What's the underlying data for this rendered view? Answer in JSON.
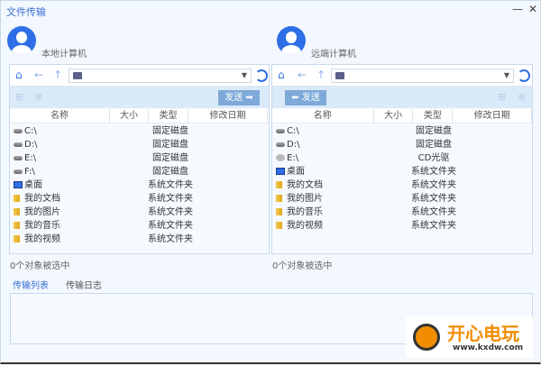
{
  "window": {
    "title": "文件传输",
    "minimize": "—",
    "close": "✕"
  },
  "local": {
    "name": "本地计算机",
    "send": "发送 ➡",
    "status": "0个对象被选中",
    "columns": [
      "名称",
      "大小",
      "类型",
      "修改日期"
    ],
    "rows": [
      {
        "name": "C:\\",
        "type": "固定磁盘",
        "icon": "drive"
      },
      {
        "name": "D:\\",
        "type": "固定磁盘",
        "icon": "drive"
      },
      {
        "name": "E:\\",
        "type": "固定磁盘",
        "icon": "drive"
      },
      {
        "name": "F:\\",
        "type": "固定磁盘",
        "icon": "drive"
      },
      {
        "name": "桌面",
        "type": "系统文件夹",
        "icon": "desktop"
      },
      {
        "name": "我的文档",
        "type": "系统文件夹",
        "icon": "folder"
      },
      {
        "name": "我的图片",
        "type": "系统文件夹",
        "icon": "folder"
      },
      {
        "name": "我的音乐",
        "type": "系统文件夹",
        "icon": "folder"
      },
      {
        "name": "我的视频",
        "type": "系统文件夹",
        "icon": "folder"
      }
    ]
  },
  "remote": {
    "name": "远端计算机",
    "send": "⬅ 发送",
    "status": "0个对象被选中",
    "columns": [
      "名称",
      "大小",
      "类型",
      "修改日期"
    ],
    "rows": [
      {
        "name": "C:\\",
        "type": "固定磁盘",
        "icon": "drive"
      },
      {
        "name": "D:\\",
        "type": "固定磁盘",
        "icon": "drive"
      },
      {
        "name": "E:\\",
        "type": "CD光驱",
        "icon": "cd"
      },
      {
        "name": "桌面",
        "type": "系统文件夹",
        "icon": "desktop"
      },
      {
        "name": "我的文档",
        "type": "系统文件夹",
        "icon": "folder"
      },
      {
        "name": "我的图片",
        "type": "系统文件夹",
        "icon": "folder"
      },
      {
        "name": "我的音乐",
        "type": "系统文件夹",
        "icon": "folder"
      },
      {
        "name": "我的视频",
        "type": "系统文件夹",
        "icon": "folder"
      }
    ]
  },
  "tabs": [
    {
      "label": "传输列表",
      "active": true
    },
    {
      "label": "传输日志",
      "active": false
    }
  ],
  "watermark": {
    "title": "开心电玩",
    "url": "www.kxdw.com"
  },
  "colors": {
    "accent": "#2e6ee6",
    "send_button": "#7fa9d8",
    "toolbar": "#dbeaf9"
  }
}
